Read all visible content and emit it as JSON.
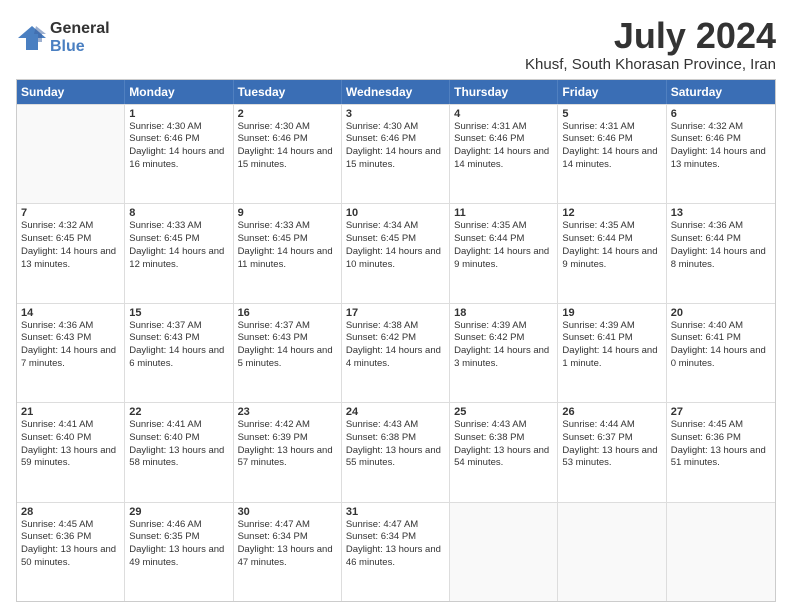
{
  "logo": {
    "general": "General",
    "blue": "Blue"
  },
  "title": "July 2024",
  "subtitle": "Khusf, South Khorasan Province, Iran",
  "header_days": [
    "Sunday",
    "Monday",
    "Tuesday",
    "Wednesday",
    "Thursday",
    "Friday",
    "Saturday"
  ],
  "rows": [
    [
      {
        "day": "",
        "sunrise": "",
        "sunset": "",
        "daylight": ""
      },
      {
        "day": "1",
        "sunrise": "Sunrise: 4:30 AM",
        "sunset": "Sunset: 6:46 PM",
        "daylight": "Daylight: 14 hours and 16 minutes."
      },
      {
        "day": "2",
        "sunrise": "Sunrise: 4:30 AM",
        "sunset": "Sunset: 6:46 PM",
        "daylight": "Daylight: 14 hours and 15 minutes."
      },
      {
        "day": "3",
        "sunrise": "Sunrise: 4:30 AM",
        "sunset": "Sunset: 6:46 PM",
        "daylight": "Daylight: 14 hours and 15 minutes."
      },
      {
        "day": "4",
        "sunrise": "Sunrise: 4:31 AM",
        "sunset": "Sunset: 6:46 PM",
        "daylight": "Daylight: 14 hours and 14 minutes."
      },
      {
        "day": "5",
        "sunrise": "Sunrise: 4:31 AM",
        "sunset": "Sunset: 6:46 PM",
        "daylight": "Daylight: 14 hours and 14 minutes."
      },
      {
        "day": "6",
        "sunrise": "Sunrise: 4:32 AM",
        "sunset": "Sunset: 6:46 PM",
        "daylight": "Daylight: 14 hours and 13 minutes."
      }
    ],
    [
      {
        "day": "7",
        "sunrise": "Sunrise: 4:32 AM",
        "sunset": "Sunset: 6:45 PM",
        "daylight": "Daylight: 14 hours and 13 minutes."
      },
      {
        "day": "8",
        "sunrise": "Sunrise: 4:33 AM",
        "sunset": "Sunset: 6:45 PM",
        "daylight": "Daylight: 14 hours and 12 minutes."
      },
      {
        "day": "9",
        "sunrise": "Sunrise: 4:33 AM",
        "sunset": "Sunset: 6:45 PM",
        "daylight": "Daylight: 14 hours and 11 minutes."
      },
      {
        "day": "10",
        "sunrise": "Sunrise: 4:34 AM",
        "sunset": "Sunset: 6:45 PM",
        "daylight": "Daylight: 14 hours and 10 minutes."
      },
      {
        "day": "11",
        "sunrise": "Sunrise: 4:35 AM",
        "sunset": "Sunset: 6:44 PM",
        "daylight": "Daylight: 14 hours and 9 minutes."
      },
      {
        "day": "12",
        "sunrise": "Sunrise: 4:35 AM",
        "sunset": "Sunset: 6:44 PM",
        "daylight": "Daylight: 14 hours and 9 minutes."
      },
      {
        "day": "13",
        "sunrise": "Sunrise: 4:36 AM",
        "sunset": "Sunset: 6:44 PM",
        "daylight": "Daylight: 14 hours and 8 minutes."
      }
    ],
    [
      {
        "day": "14",
        "sunrise": "Sunrise: 4:36 AM",
        "sunset": "Sunset: 6:43 PM",
        "daylight": "Daylight: 14 hours and 7 minutes."
      },
      {
        "day": "15",
        "sunrise": "Sunrise: 4:37 AM",
        "sunset": "Sunset: 6:43 PM",
        "daylight": "Daylight: 14 hours and 6 minutes."
      },
      {
        "day": "16",
        "sunrise": "Sunrise: 4:37 AM",
        "sunset": "Sunset: 6:43 PM",
        "daylight": "Daylight: 14 hours and 5 minutes."
      },
      {
        "day": "17",
        "sunrise": "Sunrise: 4:38 AM",
        "sunset": "Sunset: 6:42 PM",
        "daylight": "Daylight: 14 hours and 4 minutes."
      },
      {
        "day": "18",
        "sunrise": "Sunrise: 4:39 AM",
        "sunset": "Sunset: 6:42 PM",
        "daylight": "Daylight: 14 hours and 3 minutes."
      },
      {
        "day": "19",
        "sunrise": "Sunrise: 4:39 AM",
        "sunset": "Sunset: 6:41 PM",
        "daylight": "Daylight: 14 hours and 1 minute."
      },
      {
        "day": "20",
        "sunrise": "Sunrise: 4:40 AM",
        "sunset": "Sunset: 6:41 PM",
        "daylight": "Daylight: 14 hours and 0 minutes."
      }
    ],
    [
      {
        "day": "21",
        "sunrise": "Sunrise: 4:41 AM",
        "sunset": "Sunset: 6:40 PM",
        "daylight": "Daylight: 13 hours and 59 minutes."
      },
      {
        "day": "22",
        "sunrise": "Sunrise: 4:41 AM",
        "sunset": "Sunset: 6:40 PM",
        "daylight": "Daylight: 13 hours and 58 minutes."
      },
      {
        "day": "23",
        "sunrise": "Sunrise: 4:42 AM",
        "sunset": "Sunset: 6:39 PM",
        "daylight": "Daylight: 13 hours and 57 minutes."
      },
      {
        "day": "24",
        "sunrise": "Sunrise: 4:43 AM",
        "sunset": "Sunset: 6:38 PM",
        "daylight": "Daylight: 13 hours and 55 minutes."
      },
      {
        "day": "25",
        "sunrise": "Sunrise: 4:43 AM",
        "sunset": "Sunset: 6:38 PM",
        "daylight": "Daylight: 13 hours and 54 minutes."
      },
      {
        "day": "26",
        "sunrise": "Sunrise: 4:44 AM",
        "sunset": "Sunset: 6:37 PM",
        "daylight": "Daylight: 13 hours and 53 minutes."
      },
      {
        "day": "27",
        "sunrise": "Sunrise: 4:45 AM",
        "sunset": "Sunset: 6:36 PM",
        "daylight": "Daylight: 13 hours and 51 minutes."
      }
    ],
    [
      {
        "day": "28",
        "sunrise": "Sunrise: 4:45 AM",
        "sunset": "Sunset: 6:36 PM",
        "daylight": "Daylight: 13 hours and 50 minutes."
      },
      {
        "day": "29",
        "sunrise": "Sunrise: 4:46 AM",
        "sunset": "Sunset: 6:35 PM",
        "daylight": "Daylight: 13 hours and 49 minutes."
      },
      {
        "day": "30",
        "sunrise": "Sunrise: 4:47 AM",
        "sunset": "Sunset: 6:34 PM",
        "daylight": "Daylight: 13 hours and 47 minutes."
      },
      {
        "day": "31",
        "sunrise": "Sunrise: 4:47 AM",
        "sunset": "Sunset: 6:34 PM",
        "daylight": "Daylight: 13 hours and 46 minutes."
      },
      {
        "day": "",
        "sunrise": "",
        "sunset": "",
        "daylight": ""
      },
      {
        "day": "",
        "sunrise": "",
        "sunset": "",
        "daylight": ""
      },
      {
        "day": "",
        "sunrise": "",
        "sunset": "",
        "daylight": ""
      }
    ]
  ]
}
